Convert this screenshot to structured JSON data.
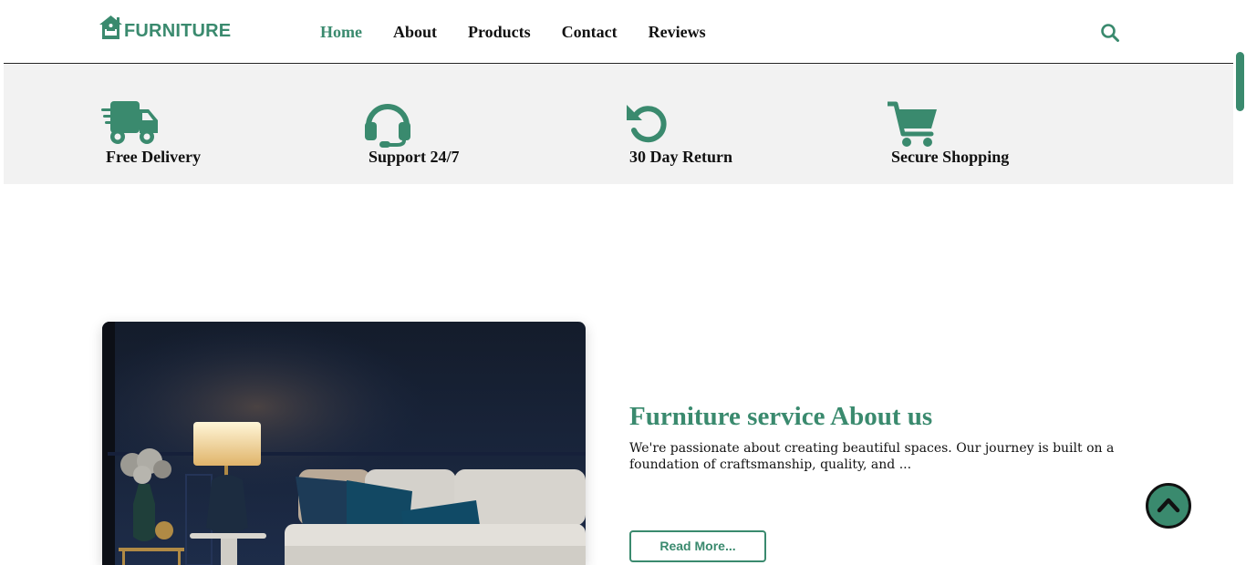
{
  "brand": {
    "logo_text": "FURNITURE",
    "accent_color": "#3a8a6e"
  },
  "nav": {
    "items": [
      {
        "label": "Home",
        "active": true
      },
      {
        "label": "About",
        "active": false
      },
      {
        "label": "Products",
        "active": false
      },
      {
        "label": "Contact",
        "active": false
      },
      {
        "label": "Reviews",
        "active": false
      }
    ],
    "search_icon": "search-icon"
  },
  "features": [
    {
      "icon": "delivery-truck-icon",
      "label": "Free Delivery"
    },
    {
      "icon": "headset-icon",
      "label": "Support 24/7"
    },
    {
      "icon": "return-arrow-icon",
      "label": "30 Day Return"
    },
    {
      "icon": "shopping-cart-icon",
      "label": "Secure Shopping"
    }
  ],
  "about": {
    "title": "Furniture service About us",
    "text": "We're passionate about creating beautiful spaces. Our journey is built on a foundation of craftsmanship, quality, and ...",
    "button_label": "Read More..."
  },
  "back_to_top_icon": "chevron-up-icon"
}
